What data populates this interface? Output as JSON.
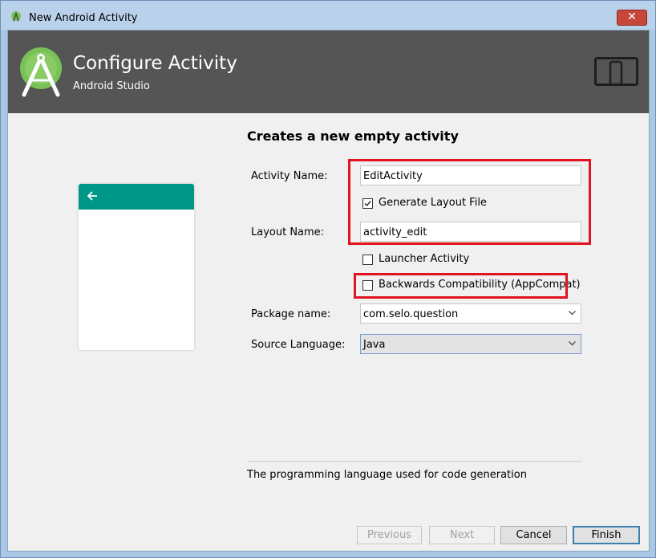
{
  "window": {
    "title": "New Android Activity",
    "close_glyph": "✕"
  },
  "header": {
    "title": "Configure Activity",
    "subtitle": "Android Studio",
    "logo_icon": "android-studio-logo",
    "device_icon": "phone-tablet-icon"
  },
  "preview": {
    "toolbar_color": "#009688",
    "back_icon": "arrow-left-icon"
  },
  "form": {
    "title": "Creates a new empty activity",
    "activity_name": {
      "label": "Activity Name:",
      "value": "EditActivity"
    },
    "generate_layout": {
      "label": "Generate Layout File",
      "checked": true
    },
    "layout_name": {
      "label": "Layout Name:",
      "value": "activity_edit"
    },
    "launcher_activity": {
      "label": "Launcher Activity",
      "checked": false
    },
    "backwards_compat": {
      "label": "Backwards Compatibility (AppCompat)",
      "checked": false
    },
    "package_name": {
      "label": "Package name:",
      "value": "com.selo.question"
    },
    "source_language": {
      "label": "Source Language:",
      "value": "Java"
    }
  },
  "description": "The programming language used for code generation",
  "buttons": {
    "previous": "Previous",
    "next": "Next",
    "cancel": "Cancel",
    "finish": "Finish"
  },
  "colors": {
    "highlight": "#e0131e",
    "header_bg": "#555555",
    "android_green": "#78c257"
  }
}
